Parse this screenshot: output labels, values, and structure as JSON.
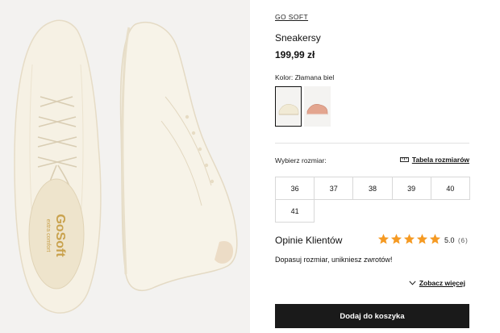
{
  "product": {
    "brand": "GO SOFT",
    "name": "Sneakersy",
    "price": "199,99 zł",
    "color_label": "Kolor: Złamana biel"
  },
  "gallery": {
    "insole_logo": "GoSoft",
    "insole_sublabel": "extra comfort"
  },
  "swatches": [
    {
      "color": "#f2ecd9",
      "selected": true
    },
    {
      "color": "#e3a58f",
      "selected": false
    }
  ],
  "sizes": {
    "label": "Wybierz rozmiar:",
    "chart_link": "Tabela rozmiarów",
    "options": [
      "36",
      "37",
      "38",
      "39",
      "40",
      "41"
    ]
  },
  "reviews": {
    "title": "Opinie Klientów",
    "rating": "5.0",
    "count": "(6)",
    "stars": 5,
    "star_color": "#f59a23",
    "fit_text": "Dopasuj rozmiar, unikniesz zwrotów!",
    "see_more": "Zobacz więcej"
  },
  "cart": {
    "button_label": "Dodaj do koszyka"
  }
}
